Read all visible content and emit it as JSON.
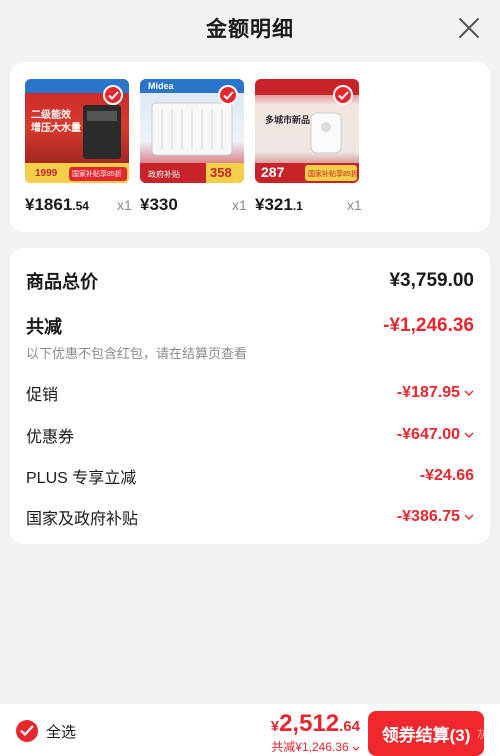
{
  "header": {
    "title": "金额明细"
  },
  "products": [
    {
      "price_main": "¥1861",
      "price_dec": ".54",
      "qty": "x1",
      "thumb_text": "二级能效 增压大水量",
      "badge": "1999",
      "subsidy": "国家补贴享85折"
    },
    {
      "price_main": "¥330",
      "price_dec": "",
      "qty": "x1",
      "thumb_text": "Midea",
      "badge": "358",
      "subsidy": "政府补贴"
    },
    {
      "price_main": "¥321",
      "price_dec": ".1",
      "qty": "x1",
      "thumb_text": "多城市新品",
      "badge": "287",
      "subsidy": "国家补贴享85折"
    }
  ],
  "summary": {
    "total_label": "商品总价",
    "total_value": "¥3,759.00",
    "reduce_label": "共减",
    "reduce_value": "-¥1,246.36",
    "note": "以下优惠不包含红包，请在结算页查看",
    "items": [
      {
        "label": "促销",
        "value": "-¥187.95"
      },
      {
        "label": "优惠券",
        "value": "-¥647.00"
      },
      {
        "label": "PLUS 专享立减",
        "value": "-¥24.66"
      },
      {
        "label": "国家及政府补贴",
        "value": "-¥386.75"
      }
    ]
  },
  "bottom": {
    "select_all": "全选",
    "amount_currency": "¥",
    "amount_main": "2,512",
    "amount_dec": ".64",
    "discount": "共减¥1,246.36",
    "checkout": "领券结算(3)",
    "watermark": "灰"
  },
  "colors": {
    "accent": "#e8262d",
    "bg": "#f2f2f2"
  }
}
